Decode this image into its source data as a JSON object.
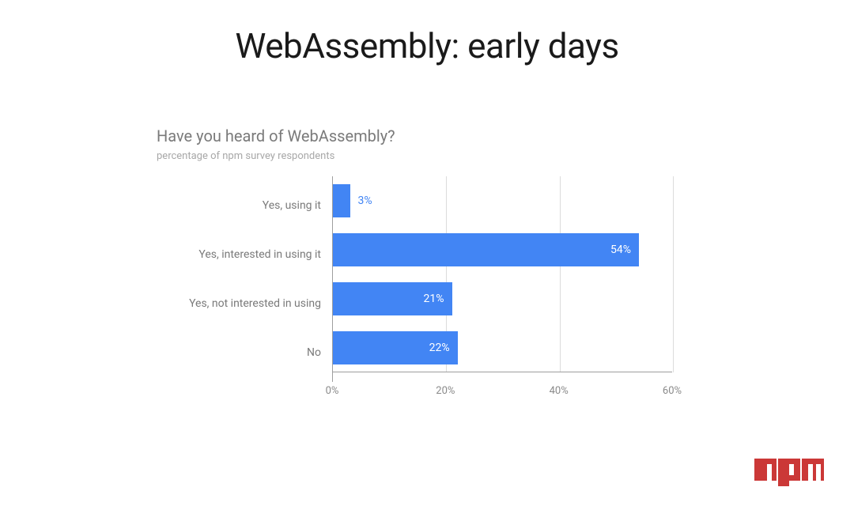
{
  "title": "WebAssembly: early days",
  "chart_data": {
    "type": "bar",
    "title": "Have you heard of WebAssembly?",
    "subtitle": "percentage of npm survey respondents",
    "categories": [
      "Yes, using it",
      "Yes, interested in using it",
      "Yes, not interested in using",
      "No"
    ],
    "values": [
      3,
      54,
      21,
      22
    ],
    "value_labels": [
      "3%",
      "54%",
      "21%",
      "22%"
    ],
    "xlabel": "",
    "ylabel": "",
    "xlim": [
      0,
      60
    ],
    "xticks": [
      0,
      20,
      40,
      60
    ],
    "xtick_labels": [
      "0%",
      "20%",
      "40%",
      "60%"
    ],
    "bar_color": "#4285f4"
  },
  "logo": {
    "name": "npm",
    "color": "#cb3837"
  }
}
